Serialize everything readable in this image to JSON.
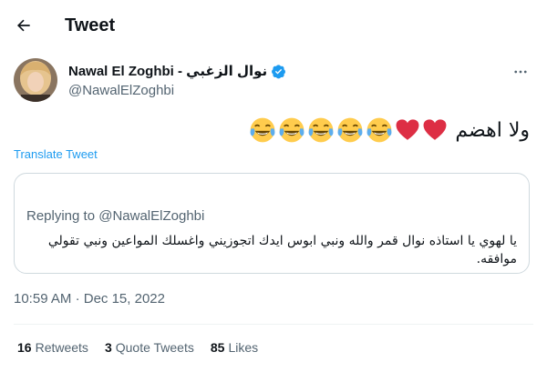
{
  "header": {
    "title": "Tweet"
  },
  "author": {
    "display_name": "Nawal El Zoghbi - نوال الزغبي",
    "handle": "@NawalElZoghbi",
    "verified": true
  },
  "tweet": {
    "text": "ولا اهضم",
    "emojis": [
      "heart",
      "heart",
      "tears-of-joy",
      "tears-of-joy",
      "tears-of-joy",
      "tears-of-joy",
      "tears-of-joy"
    ],
    "translate_label": "Translate Tweet",
    "time": "10:59 AM",
    "separator": "·",
    "date": "Dec 15, 2022"
  },
  "quoted": {
    "replying_prefix": "Replying to ",
    "replying_to": "@NawalElZoghbi",
    "text": "يا لهوي يا استاذه نوال قمر والله ونبي ابوس ايدك اتجوزيني واغسلك المواعين ونبي تقولي موافقه."
  },
  "stats": {
    "retweets_count": "16",
    "retweets_label": "Retweets",
    "quotes_count": "3",
    "quotes_label": "Quote Tweets",
    "likes_count": "85",
    "likes_label": "Likes"
  },
  "colors": {
    "accent": "#1d9bf0",
    "secondary_text": "#536471",
    "border": "#cfd9de",
    "heart": "#e0245e",
    "emoji_face": "#ffcc4d"
  }
}
